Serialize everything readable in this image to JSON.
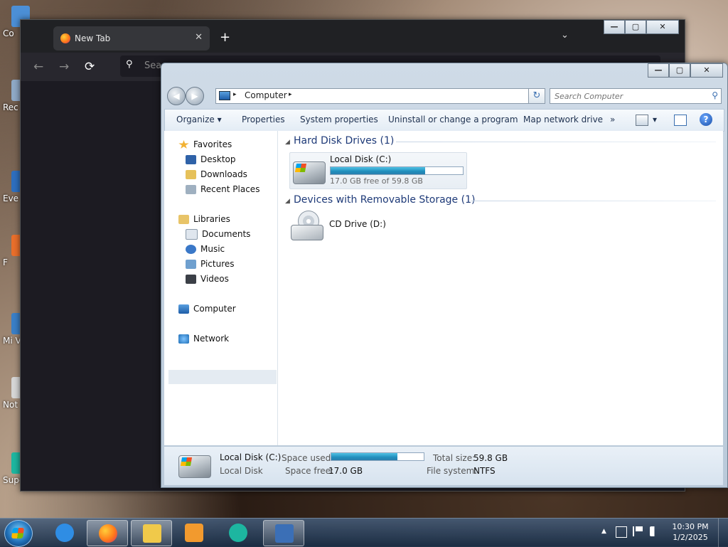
{
  "desktop": {
    "icons": [
      {
        "label": "Co",
        "color": "#4c8fd6"
      },
      {
        "label": "Rec",
        "color": "#8fa9c6"
      },
      {
        "label": "Eve",
        "color": "#2e6fbf"
      },
      {
        "label": "F",
        "color": "#e96f2b"
      },
      {
        "label": "Mi Visu",
        "color": "#3a7fc7"
      },
      {
        "label": "Not",
        "color": "#d6d6d6"
      },
      {
        "label": "Supermium",
        "color": "#1db6a0"
      }
    ]
  },
  "browser": {
    "tab_title": "New Tab",
    "tab_close": "✕",
    "new_tab": "+",
    "tab_menu": "⌄",
    "nav": {
      "back": "←",
      "forward": "→",
      "reload": "⟳"
    },
    "search_placeholder": "Sea",
    "search_icon": "search-icon",
    "window_buttons": {
      "minimize": "—",
      "maximize": "▢",
      "close": "✕"
    }
  },
  "explorer": {
    "window_buttons": {
      "minimize": "—",
      "maximize": "▢",
      "close": "✕"
    },
    "address": {
      "location": "Computer",
      "chevron": "▸",
      "dropdown": "▾"
    },
    "refresh": "↻",
    "search_placeholder": "Search Computer",
    "toolbar": {
      "organize": "Organize ▾",
      "properties": "Properties",
      "system_properties": "System properties",
      "uninstall": "Uninstall or change a program",
      "map_network": "Map network drive",
      "more": "»",
      "view_dropdown": "▾",
      "help": "?"
    },
    "nav_pane": {
      "favorites": "Favorites",
      "desktop": "Desktop",
      "downloads": "Downloads",
      "recent_places": "Recent Places",
      "libraries": "Libraries",
      "documents": "Documents",
      "music": "Music",
      "pictures": "Pictures",
      "videos": "Videos",
      "computer": "Computer",
      "network": "Network"
    },
    "groups": {
      "hdd_title": "Hard Disk Drives (1)",
      "removable_title": "Devices with Removable Storage (1)",
      "collapse_arrow": "◢"
    },
    "drives": {
      "local_disk_name": "Local Disk (C:)",
      "local_disk_free": "17.0 GB free of 59.8 GB",
      "local_disk_used_fraction": 0.716,
      "cd_name": "CD Drive (D:)"
    },
    "details": {
      "name": "Local Disk (C:)",
      "type": "Local Disk",
      "space_used_label": "Space used:",
      "space_free_label": "Space free:",
      "space_free_value": "17.0 GB",
      "total_size_label": "Total size:",
      "total_size_value": "59.8 GB",
      "file_system_label": "File system:",
      "file_system_value": "NTFS",
      "used_fraction": 0.716
    }
  },
  "taskbar": {
    "apps": [
      {
        "name": "internet-explorer",
        "color": "#2f8de4"
      },
      {
        "name": "firefox",
        "color": "#ff7a1a"
      },
      {
        "name": "file-explorer",
        "color": "#f0c94a"
      },
      {
        "name": "media-player",
        "color": "#f29a2e"
      },
      {
        "name": "supermium",
        "color": "#1db6a0"
      },
      {
        "name": "computer-window",
        "color": "#3b6fb6"
      }
    ],
    "tray": {
      "show_hidden": "▲"
    },
    "clock": {
      "time": "10:30 PM",
      "date": "1/2/2025"
    }
  }
}
